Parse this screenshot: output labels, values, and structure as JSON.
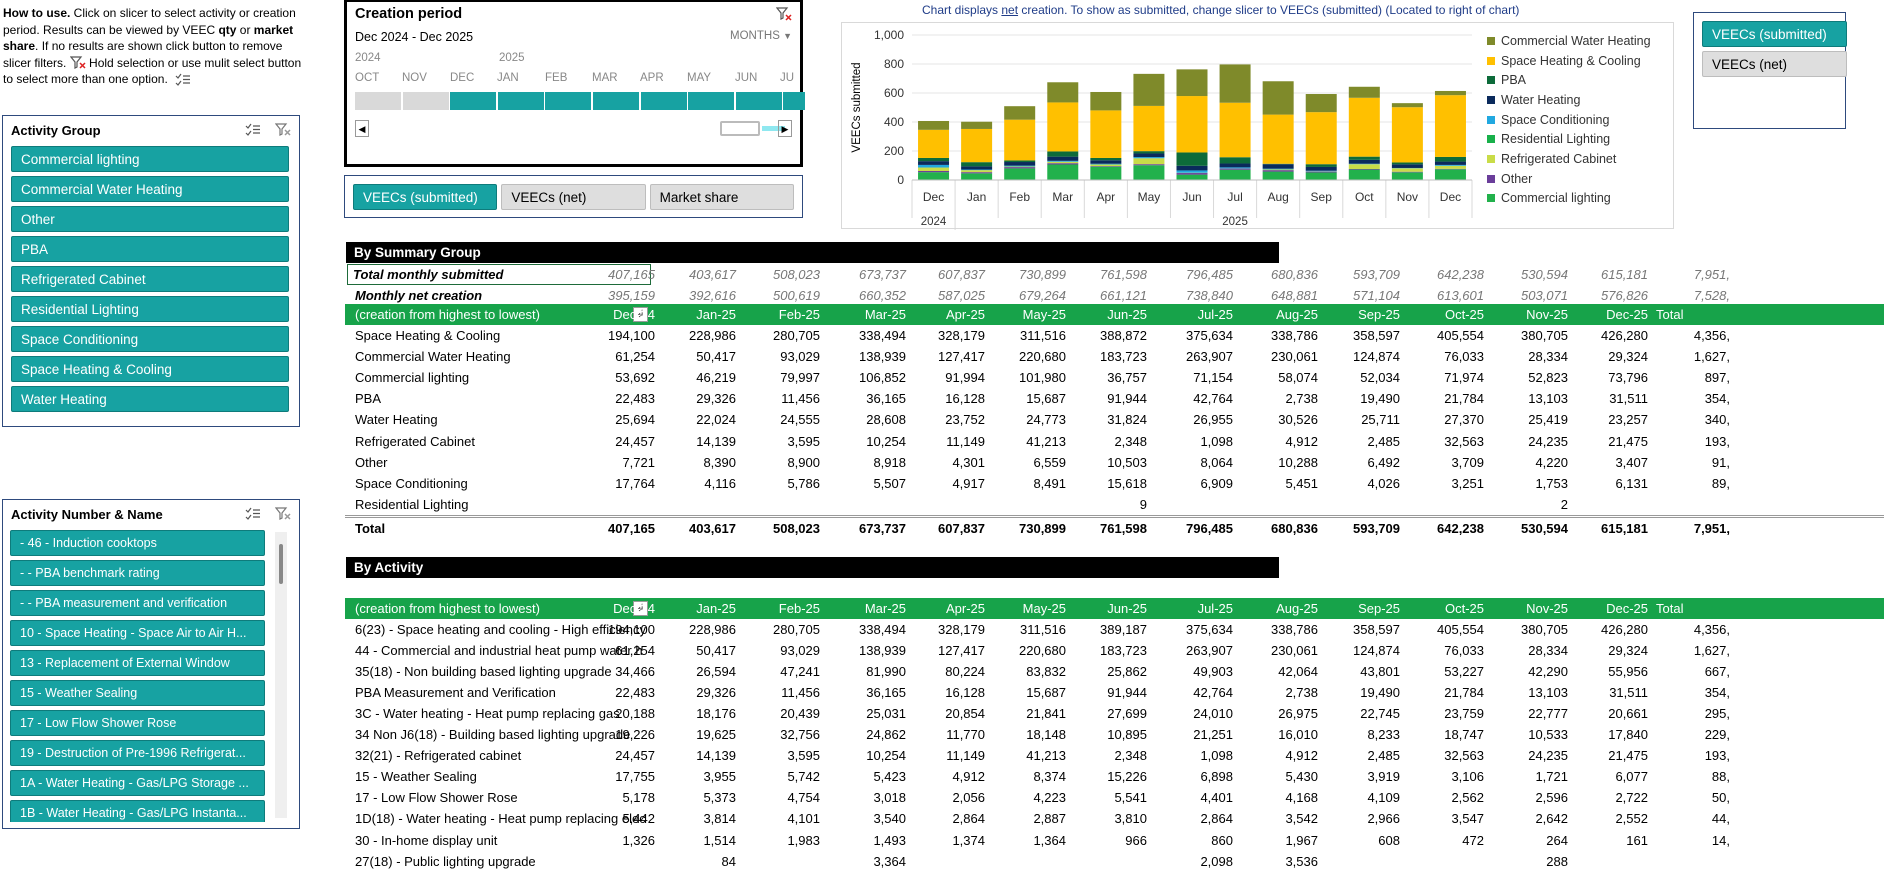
{
  "howto": {
    "title": "How to use.",
    "text1": " Click on slicer to select activity or creation period. Results can be viewed by VEEC ",
    "qty": "qty",
    "text2": " or ",
    "ms": "market share",
    "text3": ". If no results are shown click button to remove slicer filters.",
    "text4": " Hold selection or use mulit select button to select more than one option."
  },
  "activity_group": {
    "title": "Activity Group",
    "items": [
      "Commercial lighting",
      "Commercial Water Heating",
      "Other",
      "PBA",
      "Refrigerated Cabinet",
      "Residential Lighting",
      "Space Conditioning",
      "Space Heating & Cooling",
      "Water Heating"
    ]
  },
  "activity_number": {
    "title": "Activity Number & Name",
    "items": [
      " - 46 - Induction cooktops",
      " - - PBA benchmark rating",
      " - - PBA measurement and verification",
      "10 - Space Heating - Space Air to Air H...",
      "13 - Replacement of External Window",
      "15 - Weather Sealing",
      "17 - Low Flow Shower Rose",
      "19 - Destruction of Pre-1996 Refrigerat...",
      "1A - Water Heating - Gas/LPG Storage ...",
      "1B - Water Heating - Gas/LPG Instanta..."
    ]
  },
  "creation_period": {
    "title": "Creation period",
    "range": "Dec 2024 - Dec 2025",
    "unit": "MONTHS",
    "year1": "2024",
    "year2": "2025",
    "months": [
      "OCT",
      "NOV",
      "DEC",
      "JAN",
      "FEB",
      "MAR",
      "APR",
      "MAY",
      "JUN",
      "JU"
    ]
  },
  "view_buttons": [
    "VEECs (submitted)",
    "VEECs (net)",
    "Market share"
  ],
  "right_slicer": [
    "VEECs (submitted)",
    "VEECs (net)"
  ],
  "chart_note": {
    "pre": "Chart displays ",
    "net": "net",
    "post": " creation. To show as submitted, change slicer to VEECs (submitted) (Located to right of chart)"
  },
  "chart_data": {
    "type": "bar",
    "stacked": true,
    "ylabel": "VEECs submitted",
    "ylim": [
      0,
      1000
    ],
    "yticks": [
      "0",
      "200",
      "400",
      "600",
      "800",
      "1,000"
    ],
    "categories": [
      "Dec",
      "Jan",
      "Feb",
      "Mar",
      "Apr",
      "May",
      "Jun",
      "Jul",
      "Aug",
      "Sep",
      "Oct",
      "Nov",
      "Dec"
    ],
    "year_labels": [
      "2024",
      "2025"
    ],
    "legend_position": "right",
    "series": [
      {
        "name": "Commercial lighting",
        "color": "#22b14c",
        "values": [
          54,
          46,
          80,
          107,
          92,
          102,
          37,
          71,
          58,
          52,
          72,
          53,
          74
        ]
      },
      {
        "name": "Other",
        "color": "#6a3d9a",
        "values": [
          8,
          8,
          9,
          9,
          4,
          7,
          11,
          8,
          10,
          6,
          4,
          4,
          3
        ]
      },
      {
        "name": "Refrigerated Cabinet",
        "color": "#c9dc48",
        "values": [
          24,
          14,
          4,
          10,
          11,
          41,
          2,
          1,
          5,
          2,
          33,
          24,
          21
        ]
      },
      {
        "name": "Residential Lighting",
        "color": "#18b04a",
        "values": [
          0,
          0,
          0,
          0,
          0,
          0,
          0,
          0,
          0,
          0,
          0,
          0,
          0
        ]
      },
      {
        "name": "Space Conditioning",
        "color": "#21a8e0",
        "values": [
          18,
          4,
          6,
          6,
          5,
          8,
          16,
          7,
          5,
          4,
          3,
          2,
          6
        ]
      },
      {
        "name": "Water Heating",
        "color": "#0a2a5c",
        "values": [
          26,
          22,
          25,
          29,
          24,
          25,
          32,
          27,
          31,
          26,
          27,
          25,
          23
        ]
      },
      {
        "name": "PBA",
        "color": "#0d6b3a",
        "values": [
          22,
          29,
          11,
          36,
          16,
          16,
          92,
          43,
          3,
          19,
          22,
          13,
          32
        ]
      },
      {
        "name": "Space Heating & Cooling",
        "color": "#ffc000",
        "values": [
          194,
          229,
          281,
          338,
          328,
          312,
          389,
          376,
          339,
          359,
          406,
          381,
          426
        ]
      },
      {
        "name": "Commercial Water Heating",
        "color": "#7f8a2a",
        "values": [
          61,
          50,
          93,
          139,
          127,
          221,
          184,
          264,
          230,
          125,
          76,
          28,
          29
        ]
      }
    ]
  },
  "summary": {
    "title": "By Summary Group",
    "total_submitted_label": "Total monthly submitted",
    "total_submitted": [
      "407,165",
      "403,617",
      "508,023",
      "673,737",
      "607,837",
      "730,899",
      "761,598",
      "796,485",
      "680,836",
      "593,709",
      "642,238",
      "530,594",
      "615,181",
      "7,951,"
    ],
    "net_label": "Monthly net creation",
    "net": [
      "395,159",
      "392,616",
      "500,619",
      "660,352",
      "587,025",
      "679,264",
      "661,121",
      "738,840",
      "648,881",
      "571,104",
      "613,601",
      "503,071",
      "576,826",
      "7,528,"
    ],
    "header_label": "(creation from highest to lowest)",
    "months": [
      "Dec-24",
      "Jan-25",
      "Feb-25",
      "Mar-25",
      "Apr-25",
      "May-25",
      "Jun-25",
      "Jul-25",
      "Aug-25",
      "Sep-25",
      "Oct-25",
      "Nov-25",
      "Dec-25",
      "Total"
    ],
    "rows": [
      {
        "label": "Space Heating & Cooling",
        "v": [
          "194,100",
          "228,986",
          "280,705",
          "338,494",
          "328,179",
          "311,516",
          "388,872",
          "375,634",
          "338,786",
          "358,597",
          "405,554",
          "380,705",
          "426,280",
          "4,356,"
        ]
      },
      {
        "label": "Commercial Water Heating",
        "v": [
          "61,254",
          "50,417",
          "93,029",
          "138,939",
          "127,417",
          "220,680",
          "183,723",
          "263,907",
          "230,061",
          "124,874",
          "76,033",
          "28,334",
          "29,324",
          "1,627,"
        ]
      },
      {
        "label": "Commercial lighting",
        "v": [
          "53,692",
          "46,219",
          "79,997",
          "106,852",
          "91,994",
          "101,980",
          "36,757",
          "71,154",
          "58,074",
          "52,034",
          "71,974",
          "52,823",
          "73,796",
          "897,"
        ]
      },
      {
        "label": "PBA",
        "v": [
          "22,483",
          "29,326",
          "11,456",
          "36,165",
          "16,128",
          "15,687",
          "91,944",
          "42,764",
          "2,738",
          "19,490",
          "21,784",
          "13,103",
          "31,511",
          "354,"
        ]
      },
      {
        "label": "Water Heating",
        "v": [
          "25,694",
          "22,024",
          "24,555",
          "28,608",
          "23,752",
          "24,773",
          "31,824",
          "26,955",
          "30,526",
          "25,711",
          "27,370",
          "25,419",
          "23,257",
          "340,"
        ]
      },
      {
        "label": "Refrigerated Cabinet",
        "v": [
          "24,457",
          "14,139",
          "3,595",
          "10,254",
          "11,149",
          "41,213",
          "2,348",
          "1,098",
          "4,912",
          "2,485",
          "32,563",
          "24,235",
          "21,475",
          "193,"
        ]
      },
      {
        "label": "Other",
        "v": [
          "7,721",
          "8,390",
          "8,900",
          "8,918",
          "4,301",
          "6,559",
          "10,503",
          "8,064",
          "10,288",
          "6,492",
          "3,709",
          "4,220",
          "3,407",
          "91,"
        ]
      },
      {
        "label": "Space Conditioning",
        "v": [
          "17,764",
          "4,116",
          "5,786",
          "5,507",
          "4,917",
          "8,491",
          "15,618",
          "6,909",
          "5,451",
          "4,026",
          "3,251",
          "1,753",
          "6,131",
          "89,"
        ]
      },
      {
        "label": "Residential Lighting",
        "v": [
          "",
          "",
          "",
          "",
          "",
          "",
          "9",
          "",
          "",
          "",
          "",
          "2",
          "",
          ""
        ]
      }
    ],
    "total_label": "Total",
    "total": [
      "407,165",
      "403,617",
      "508,023",
      "673,737",
      "607,837",
      "730,899",
      "761,598",
      "796,485",
      "680,836",
      "593,709",
      "642,238",
      "530,594",
      "615,181",
      "7,951,"
    ]
  },
  "activity": {
    "title": "By Activity",
    "header_label": "(creation from highest to lowest)",
    "rows": [
      {
        "label": "6(23) - Space heating and cooling - High efficiency",
        "v": [
          "194,100",
          "228,986",
          "280,705",
          "338,494",
          "328,179",
          "311,516",
          "389,187",
          "375,634",
          "338,786",
          "358,597",
          "405,554",
          "380,705",
          "426,280",
          "4,356,"
        ]
      },
      {
        "label": "44 - Commercial and industrial heat pump water h",
        "v": [
          "61,254",
          "50,417",
          "93,029",
          "138,939",
          "127,417",
          "220,680",
          "183,723",
          "263,907",
          "230,061",
          "124,874",
          "76,033",
          "28,334",
          "29,324",
          "1,627,"
        ]
      },
      {
        "label": "35(18) - Non building based lighting upgrade",
        "v": [
          "34,466",
          "26,594",
          "47,241",
          "81,990",
          "80,224",
          "83,832",
          "25,862",
          "49,903",
          "42,064",
          "43,801",
          "53,227",
          "42,290",
          "55,956",
          "667,"
        ]
      },
      {
        "label": "PBA Measurement and Verification",
        "v": [
          "22,483",
          "29,326",
          "11,456",
          "36,165",
          "16,128",
          "15,687",
          "91,944",
          "42,764",
          "2,738",
          "19,490",
          "21,784",
          "13,103",
          "31,511",
          "354,"
        ]
      },
      {
        "label": "3C - Water heating - Heat pump replacing gas",
        "v": [
          "20,188",
          "18,176",
          "20,439",
          "25,031",
          "20,854",
          "21,841",
          "27,699",
          "24,010",
          "26,975",
          "22,745",
          "23,759",
          "22,777",
          "20,661",
          "295,"
        ]
      },
      {
        "label": "34 Non J6(18) - Building based lighting upgrade",
        "v": [
          "19,226",
          "19,625",
          "32,756",
          "24,862",
          "11,770",
          "18,148",
          "10,895",
          "21,251",
          "16,010",
          "8,233",
          "18,747",
          "10,533",
          "17,840",
          "229,"
        ]
      },
      {
        "label": "32(21) - Refrigerated cabinet",
        "v": [
          "24,457",
          "14,139",
          "3,595",
          "10,254",
          "11,149",
          "41,213",
          "2,348",
          "1,098",
          "4,912",
          "2,485",
          "32,563",
          "24,235",
          "21,475",
          "193,"
        ]
      },
      {
        "label": "15 - Weather Sealing",
        "v": [
          "17,755",
          "3,955",
          "5,742",
          "5,423",
          "4,912",
          "8,374",
          "15,226",
          "6,898",
          "5,430",
          "3,919",
          "3,106",
          "1,721",
          "6,077",
          "88,"
        ]
      },
      {
        "label": "17 - Low Flow Shower Rose",
        "v": [
          "5,178",
          "5,373",
          "4,754",
          "3,018",
          "2,056",
          "4,223",
          "5,541",
          "4,401",
          "4,168",
          "4,109",
          "2,562",
          "2,596",
          "2,722",
          "50,"
        ]
      },
      {
        "label": "1D(18) - Water heating - Heat pump replacing elec",
        "v": [
          "5,442",
          "3,814",
          "4,101",
          "3,540",
          "2,864",
          "2,887",
          "3,810",
          "2,864",
          "3,542",
          "2,966",
          "3,547",
          "2,642",
          "2,552",
          "44,"
        ]
      },
      {
        "label": "30 - In-home display unit",
        "v": [
          "1,326",
          "1,514",
          "1,983",
          "1,493",
          "1,374",
          "1,364",
          "966",
          "860",
          "1,967",
          "608",
          "472",
          "264",
          "161",
          "14,"
        ]
      },
      {
        "label": "27(18) - Public lighting upgrade",
        "v": [
          "",
          "84",
          "",
          "3,364",
          "",
          "",
          "",
          "2,098",
          "3,536",
          "",
          "",
          "288",
          "",
          ""
        ]
      }
    ]
  }
}
